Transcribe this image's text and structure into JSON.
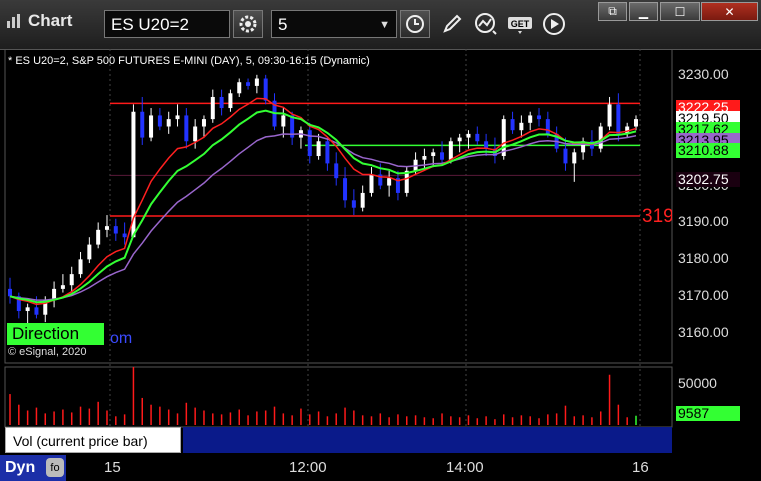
{
  "app": {
    "title": "Chart"
  },
  "toolbar": {
    "symbol": "ES U20=2",
    "interval": "5",
    "buttons": [
      "settings-icon",
      "clock-icon",
      "pencil-icon",
      "study-icon",
      "get-icon",
      "play-icon"
    ]
  },
  "window_controls": [
    "restore-icon",
    "minimize-icon",
    "maximize-icon",
    "close-icon"
  ],
  "chart": {
    "subtitle": "* ES U20=2, S&P 500 FUTURES E-MINI (DAY), 5, 09:30-16:15 (Dynamic)",
    "watermark": "© eSignal, 2020",
    "watermark_link": "om",
    "direction_tag": "Direction",
    "edge_label": "319",
    "price_ticks": [
      "3230.00",
      "3220.00",
      "3210.00",
      "3200.00",
      "3190.00",
      "3180.00",
      "3170.00",
      "3160.00"
    ],
    "price_tags": [
      {
        "text": "3222.25",
        "bg": "#ff1a1a",
        "color": "#ffffff"
      },
      {
        "text": "3219.50",
        "bg": "#ffffff",
        "color": "#000000"
      },
      {
        "text": "3217.62",
        "bg": "#33ff33",
        "color": "#000000"
      },
      {
        "text": "3213.95",
        "bg": "#9966cc",
        "color": "#000000"
      },
      {
        "text": "3210.88",
        "bg": "#33ff33",
        "color": "#000000"
      },
      {
        "text": "3202.75",
        "bg": "#1a0010",
        "color": "#ffffff"
      }
    ],
    "time_ticks": [
      "15",
      "12:00",
      "14:00",
      "16"
    ]
  },
  "volume": {
    "label": "Vol (current price bar)",
    "close": "×",
    "ticks": [
      "50000"
    ],
    "current_tag": {
      "text": "9587",
      "bg": "#33ff33",
      "color": "#000000"
    }
  },
  "bottom": {
    "dyn_label": "Dyn",
    "dyn_icon": "fo"
  },
  "colors": {
    "up": "#ffffff",
    "down": "#2233ff",
    "ema_fast": "#ff2020",
    "ema_slow": "#9966cc",
    "green_line": "#33ff33",
    "level_red": "#ff1a1a",
    "level_dark": "#5a1a3a",
    "volume_bar": "#ff1a1a"
  },
  "chart_data": {
    "type": "candlestick",
    "symbol": "ES U20=2",
    "ylim": [
      3153,
      3237
    ],
    "levels": [
      3222.25,
      3202.75,
      3191.75,
      3210.88
    ],
    "candles": [
      [
        3172,
        3175,
        3168,
        3170
      ],
      [
        3170,
        3171,
        3164,
        3166
      ],
      [
        3166,
        3168,
        3162,
        3167
      ],
      [
        3167,
        3170,
        3164,
        3165
      ],
      [
        3165,
        3170,
        3163,
        3169
      ],
      [
        3169,
        3174,
        3167,
        3172
      ],
      [
        3172,
        3176,
        3171,
        3173
      ],
      [
        3173,
        3178,
        3171,
        3176
      ],
      [
        3176,
        3182,
        3175,
        3180
      ],
      [
        3180,
        3186,
        3179,
        3184
      ],
      [
        3184,
        3190,
        3183,
        3188
      ],
      [
        3188,
        3192,
        3186,
        3189
      ],
      [
        3189,
        3191,
        3185,
        3187
      ],
      [
        3187,
        3190,
        3184,
        3186
      ],
      [
        3186,
        3222,
        3186,
        3220
      ],
      [
        3220,
        3224,
        3211,
        3213
      ],
      [
        3213,
        3221,
        3212,
        3219
      ],
      [
        3219,
        3221,
        3215,
        3216
      ],
      [
        3216,
        3220,
        3214,
        3218
      ],
      [
        3218,
        3222,
        3216,
        3219
      ],
      [
        3219,
        3221,
        3210,
        3212
      ],
      [
        3212,
        3218,
        3210,
        3216
      ],
      [
        3216,
        3219,
        3213,
        3218
      ],
      [
        3218,
        3226,
        3217,
        3224
      ],
      [
        3224,
        3226,
        3219,
        3221
      ],
      [
        3221,
        3226,
        3220,
        3225
      ],
      [
        3225,
        3229,
        3224,
        3228
      ],
      [
        3228,
        3229,
        3226,
        3227
      ],
      [
        3227,
        3230,
        3225,
        3229
      ],
      [
        3229,
        3230,
        3222,
        3223
      ],
      [
        3223,
        3225,
        3215,
        3216
      ],
      [
        3216,
        3221,
        3213,
        3219
      ],
      [
        3219,
        3220,
        3211,
        3213
      ],
      [
        3213,
        3216,
        3210,
        3215
      ],
      [
        3215,
        3217,
        3206,
        3208
      ],
      [
        3208,
        3214,
        3207,
        3212
      ],
      [
        3212,
        3213,
        3204,
        3206
      ],
      [
        3206,
        3209,
        3200,
        3202
      ],
      [
        3202,
        3205,
        3194,
        3196
      ],
      [
        3196,
        3199,
        3192,
        3194
      ],
      [
        3194,
        3200,
        3193,
        3198
      ],
      [
        3198,
        3205,
        3197,
        3203
      ],
      [
        3203,
        3206,
        3199,
        3200
      ],
      [
        3200,
        3204,
        3197,
        3202
      ],
      [
        3202,
        3204,
        3196,
        3198
      ],
      [
        3198,
        3205,
        3197,
        3204
      ],
      [
        3204,
        3209,
        3203,
        3207
      ],
      [
        3207,
        3210,
        3204,
        3208
      ],
      [
        3208,
        3210,
        3205,
        3209
      ],
      [
        3209,
        3212,
        3206,
        3207
      ],
      [
        3207,
        3213,
        3206,
        3212
      ],
      [
        3212,
        3214,
        3209,
        3213
      ],
      [
        3213,
        3215,
        3210,
        3214
      ],
      [
        3214,
        3216,
        3211,
        3212
      ],
      [
        3212,
        3214,
        3208,
        3210
      ],
      [
        3210,
        3213,
        3206,
        3208
      ],
      [
        3208,
        3219,
        3207,
        3218
      ],
      [
        3218,
        3220,
        3214,
        3215
      ],
      [
        3215,
        3219,
        3213,
        3217
      ],
      [
        3217,
        3220,
        3215,
        3219
      ],
      [
        3219,
        3221,
        3216,
        3218
      ],
      [
        3218,
        3220,
        3213,
        3214
      ],
      [
        3214,
        3216,
        3209,
        3210
      ],
      [
        3210,
        3213,
        3204,
        3206
      ],
      [
        3206,
        3210,
        3201,
        3209
      ],
      [
        3209,
        3213,
        3207,
        3212
      ],
      [
        3212,
        3215,
        3208,
        3210
      ],
      [
        3210,
        3217,
        3209,
        3216
      ],
      [
        3216,
        3224,
        3215,
        3222
      ],
      [
        3222,
        3225,
        3212,
        3214
      ],
      [
        3214,
        3217,
        3213,
        3216
      ],
      [
        3216,
        3219,
        3215,
        3218
      ]
    ],
    "volume_max": 60000,
    "volume": [
      32000,
      21000,
      15000,
      18000,
      12000,
      14000,
      16000,
      13000,
      19000,
      17000,
      24000,
      15000,
      9000,
      11000,
      60000,
      28000,
      21000,
      19000,
      16000,
      12000,
      23000,
      18000,
      15000,
      12000,
      11000,
      13000,
      16000,
      10000,
      14000,
      15000,
      19000,
      12000,
      10000,
      17000,
      11000,
      14000,
      9000,
      12000,
      18000,
      15000,
      10000,
      9000,
      12000,
      8000,
      11000,
      9000,
      10000,
      8000,
      7000,
      12000,
      9000,
      8000,
      10000,
      7000,
      9000,
      6000,
      11000,
      8000,
      10000,
      9000,
      7000,
      11000,
      12000,
      20000,
      9000,
      10000,
      8000,
      14000,
      52000,
      21000,
      8000,
      9587
    ]
  }
}
